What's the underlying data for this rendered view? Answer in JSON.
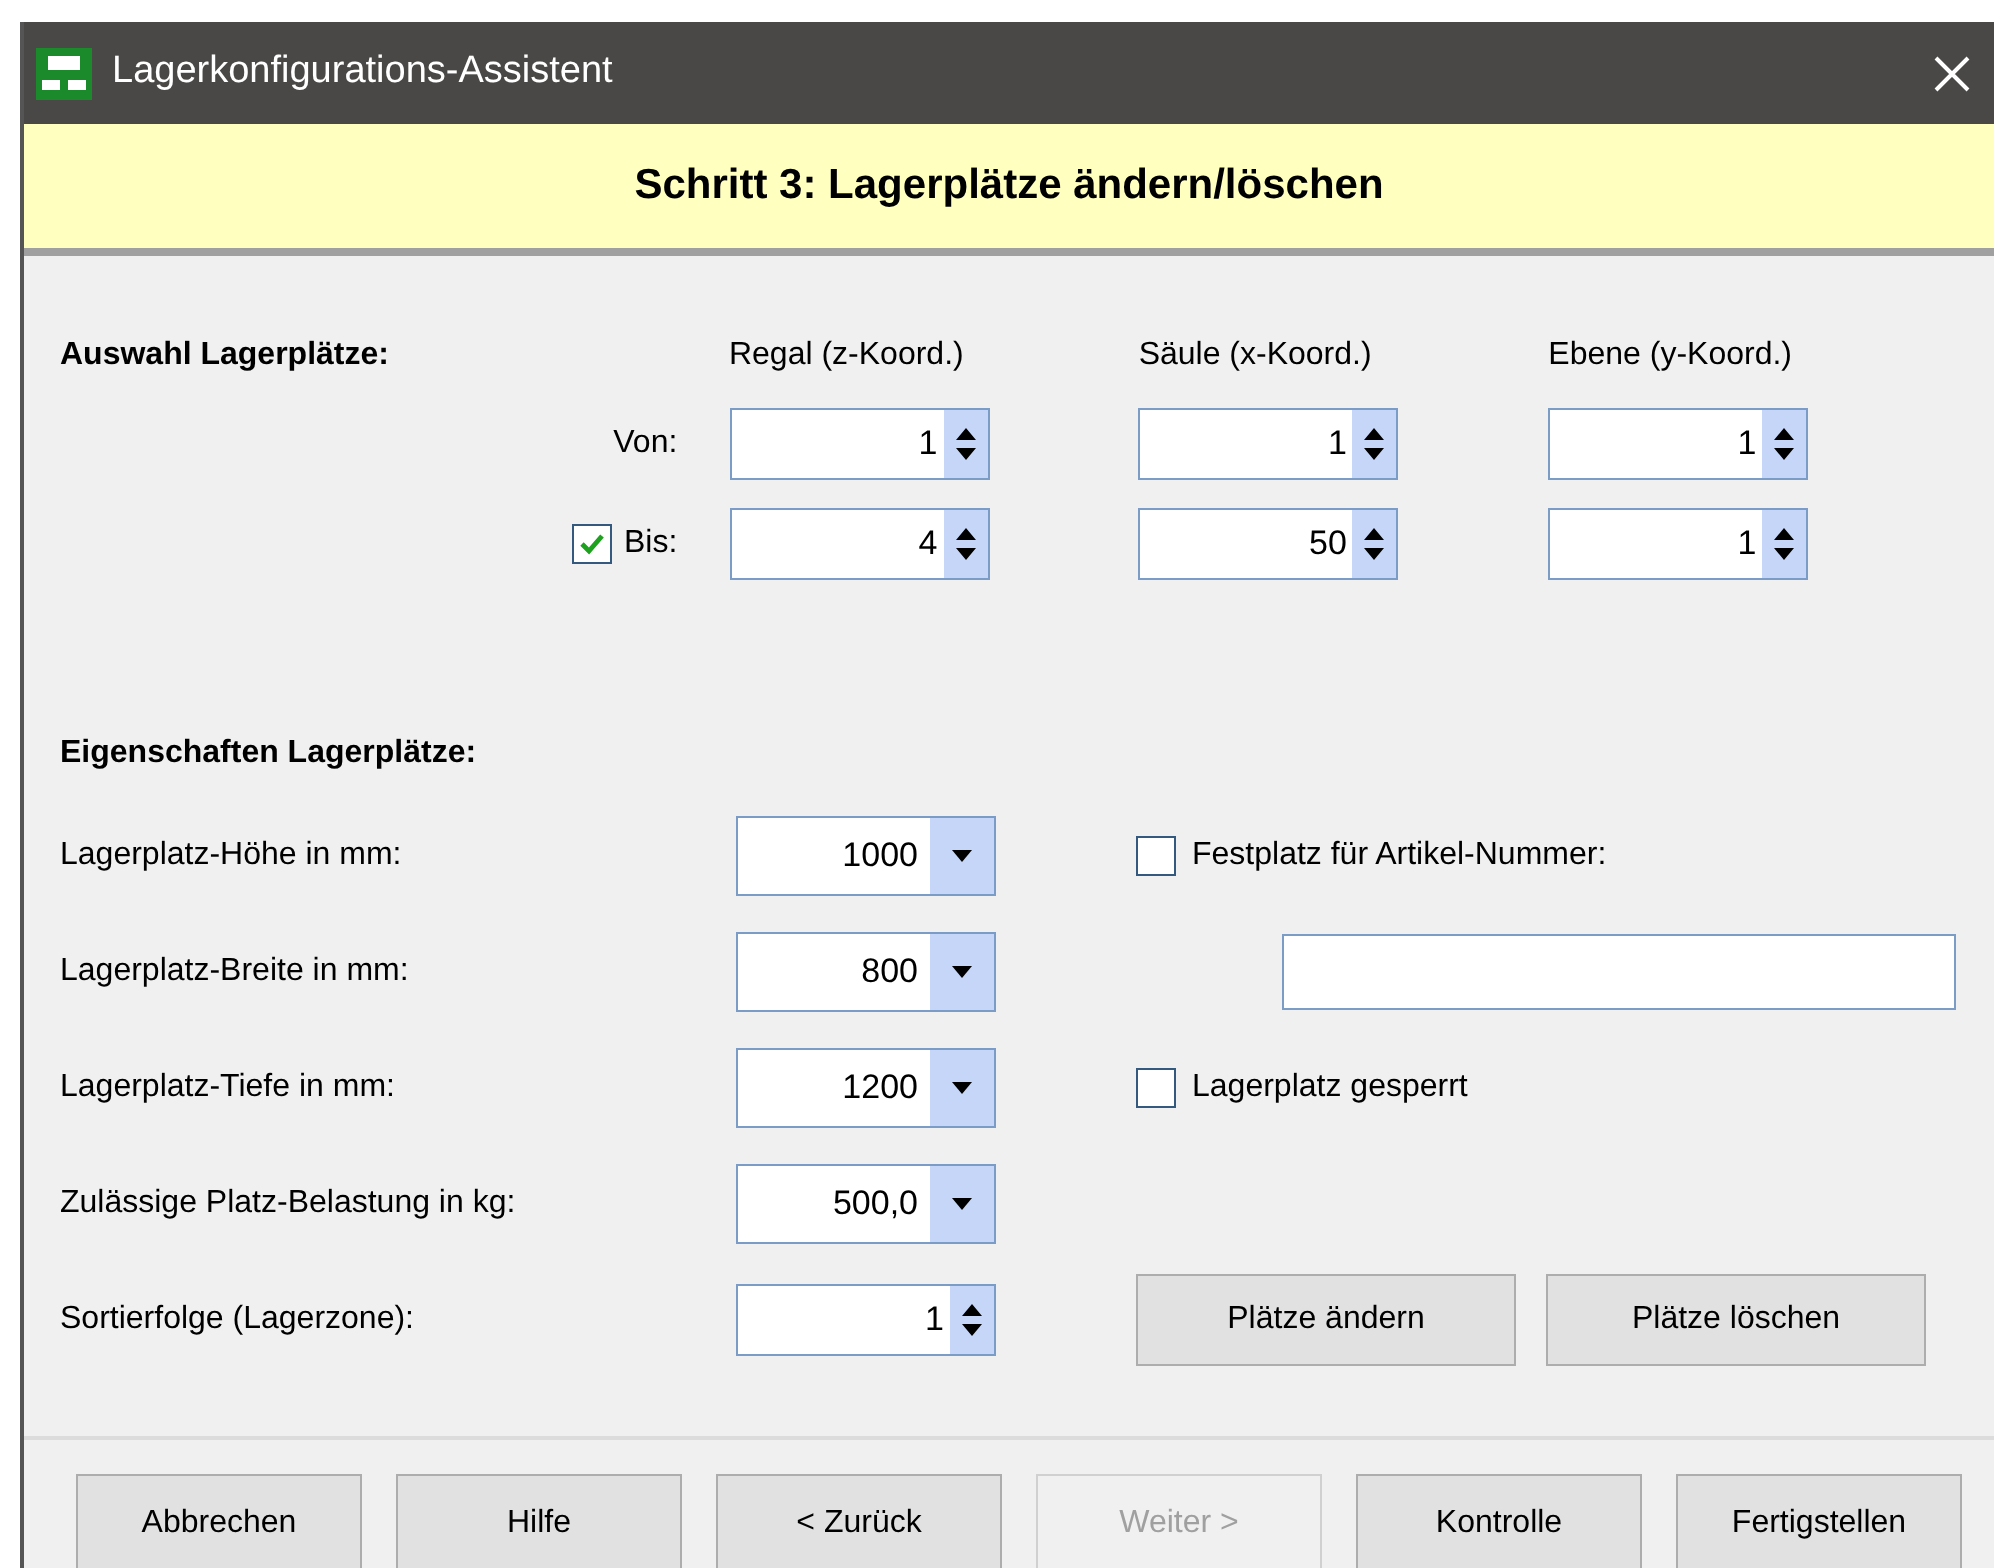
{
  "window": {
    "title": "Lagerkonfigurations-Assistent"
  },
  "step_title": "Schritt 3: Lagerplätze ändern/löschen",
  "selection": {
    "heading": "Auswahl Lagerplätze:",
    "columns": [
      "Regal (z-Koord.)",
      "Säule (x-Koord.)",
      "Ebene (y-Koord.)"
    ],
    "rows": [
      {
        "label": "Von:",
        "kind": "plain",
        "values": [
          "1",
          "1",
          "1"
        ]
      },
      {
        "label": "Bis:",
        "kind": "checkbox",
        "checked": true,
        "values": [
          "4",
          "50",
          "1"
        ]
      }
    ]
  },
  "properties": {
    "heading": "Eigenschaften Lagerplätze:",
    "fields": [
      {
        "label": "Lagerplatz-Höhe in mm:",
        "kind": "dropdown",
        "value": "1000"
      },
      {
        "label": "Lagerplatz-Breite in mm:",
        "kind": "dropdown",
        "value": "800"
      },
      {
        "label": "Lagerplatz-Tiefe in mm:",
        "kind": "dropdown",
        "value": "1200"
      },
      {
        "label": "Zulässige Platz-Belastung in kg:",
        "kind": "dropdown",
        "value": "500,0"
      },
      {
        "label": "Sortierfolge (Lagerzone):",
        "kind": "spinner",
        "value": "1"
      }
    ],
    "fixed_slot": {
      "label": "Festplatz für Artikel-Nummer:",
      "checked": false
    },
    "blocked": {
      "label": "Lagerplatz gesperrt",
      "checked": false
    },
    "actions": [
      "Plätze ändern",
      "Plätze löschen"
    ]
  },
  "footer_buttons": [
    {
      "label": "Abbrechen",
      "disabled": false
    },
    {
      "label": "Hilfe",
      "disabled": false
    },
    {
      "label": "< Zurück",
      "disabled": false
    },
    {
      "label": "Weiter >",
      "disabled": true
    },
    {
      "label": "Kontrolle",
      "disabled": false
    },
    {
      "label": "Fertigstellen",
      "disabled": false
    }
  ]
}
